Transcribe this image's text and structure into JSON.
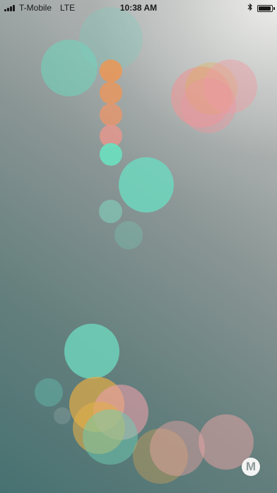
{
  "status_bar": {
    "carrier": "T-Mobile",
    "network": "LTE",
    "time": "10:38 AM",
    "signal_bars": 4,
    "bluetooth_icon": "bluetooth-icon",
    "battery_icon": "battery-icon"
  },
  "menu_button": {
    "label": "M"
  },
  "colors": {
    "teal": "#6fd8c0",
    "orange": "#e8a060",
    "pink": "#e8a0a0",
    "gold": "#e2b040"
  }
}
